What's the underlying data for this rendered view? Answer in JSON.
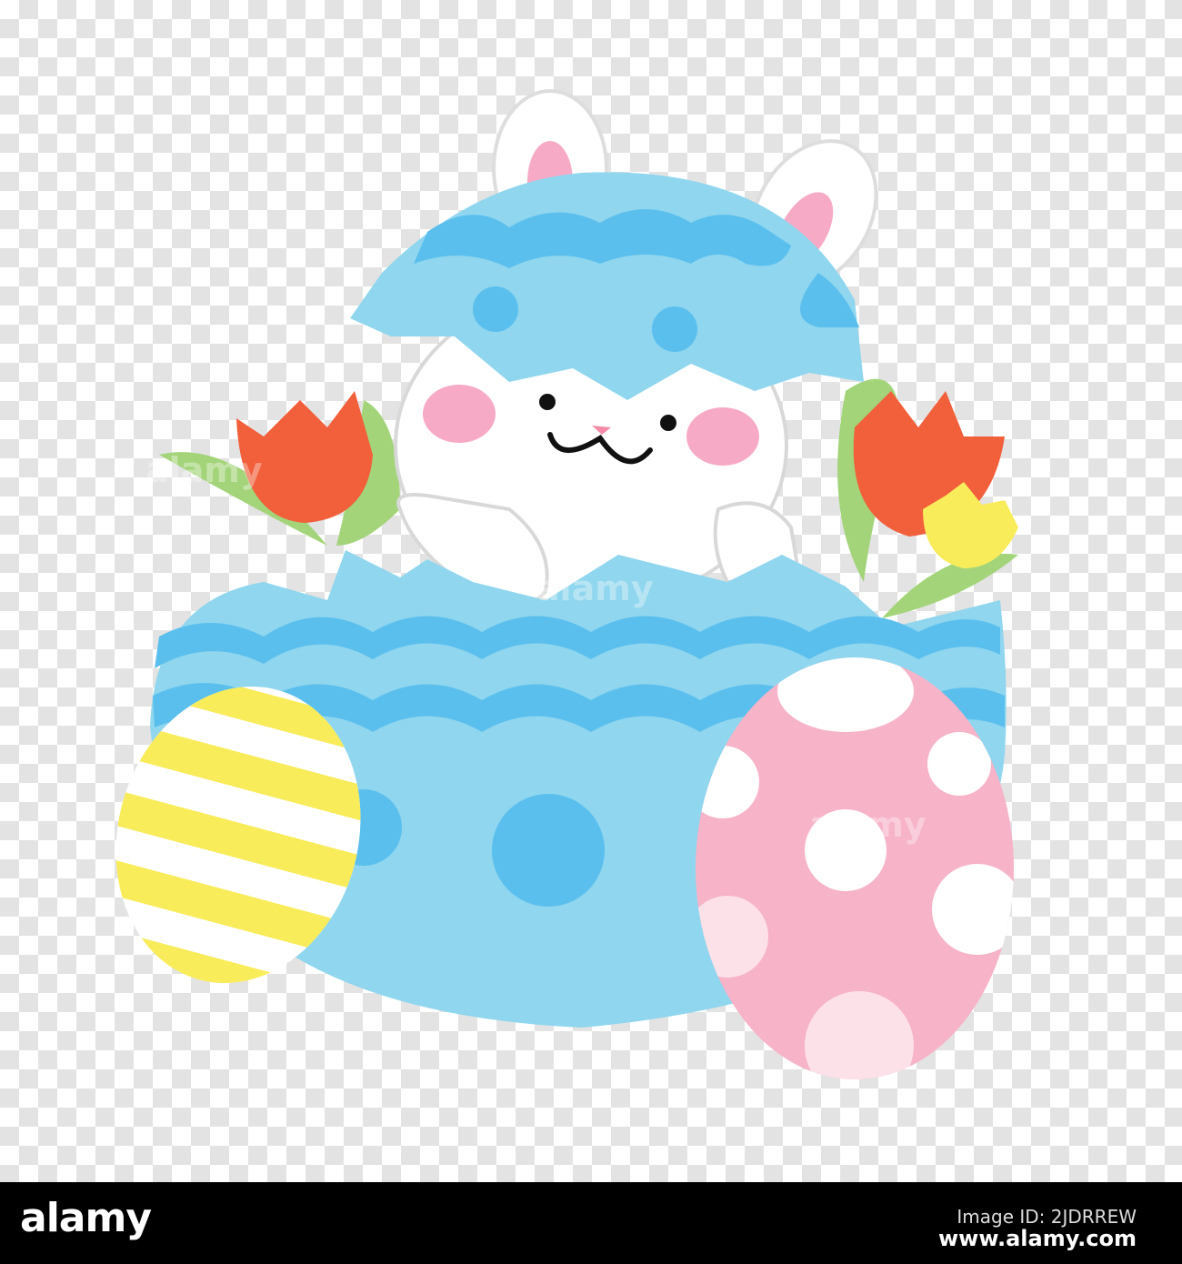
{
  "watermark": {
    "logo": "alamy"
  },
  "footer": {
    "logo": "alamy",
    "image_id": "Image ID: 2JDRREW",
    "website": "www.alamy.com"
  },
  "colors": {
    "egg_light_blue": "#8fd6ee",
    "egg_blue": "#5bbfee",
    "tulip_red": "#f15f3b",
    "tulip_yellow": "#f9ec5a",
    "leaf_green": "#a3d47a",
    "pink_egg": "#f7b3c8",
    "cheek_pink": "#f7aac6"
  }
}
